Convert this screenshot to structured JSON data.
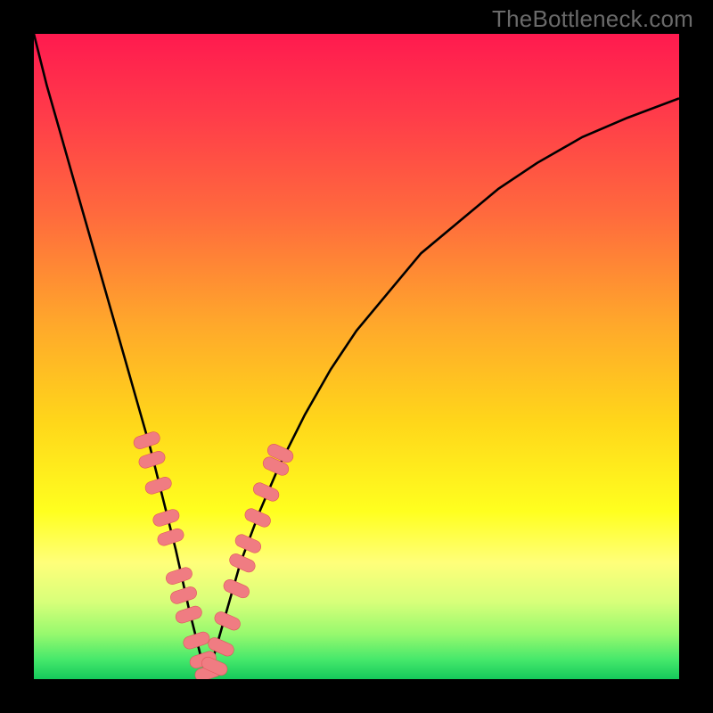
{
  "watermark": "TheBottleneck.com",
  "colors": {
    "frame": "#000000",
    "gradient_stops": [
      {
        "offset": 0.0,
        "color": "#ff1a4f"
      },
      {
        "offset": 0.12,
        "color": "#ff3a4a"
      },
      {
        "offset": 0.28,
        "color": "#ff6a3d"
      },
      {
        "offset": 0.45,
        "color": "#ffa82b"
      },
      {
        "offset": 0.6,
        "color": "#ffd61a"
      },
      {
        "offset": 0.74,
        "color": "#ffff1f"
      },
      {
        "offset": 0.82,
        "color": "#ffff7a"
      },
      {
        "offset": 0.88,
        "color": "#d8ff7a"
      },
      {
        "offset": 0.93,
        "color": "#97f96e"
      },
      {
        "offset": 0.97,
        "color": "#45e86b"
      },
      {
        "offset": 1.0,
        "color": "#15c95b"
      }
    ],
    "curve": "#000000",
    "bead_fill": "#f07c82",
    "bead_stroke": "#e0555c"
  },
  "chart_data": {
    "type": "line",
    "title": "",
    "xlabel": "",
    "ylabel": "",
    "xlim": [
      0,
      100
    ],
    "ylim": [
      0,
      100
    ],
    "grid": false,
    "legend": false,
    "notes": "Two curves starting from opposite top corners descending to meet near x≈27 at y≈0, forming a sharp V. Pink bead markers cluster on both curves in the y≈0–37 band. Background is a vertical spectral gradient (red→green). Axes are unlabeled; numeric x/y are relative 0–100 estimates from pixel position.",
    "series": [
      {
        "name": "left_curve",
        "x": [
          0,
          2,
          4,
          6,
          8,
          10,
          12,
          14,
          16,
          18,
          20,
          22,
          24,
          25,
          26,
          27
        ],
        "y": [
          100,
          92,
          85,
          78,
          71,
          64,
          57,
          50,
          43,
          36,
          28,
          20,
          11,
          7,
          3,
          0
        ]
      },
      {
        "name": "right_curve",
        "x": [
          27,
          28,
          30,
          32,
          35,
          38,
          42,
          46,
          50,
          55,
          60,
          66,
          72,
          78,
          85,
          92,
          100
        ],
        "y": [
          0,
          4,
          11,
          18,
          26,
          33,
          41,
          48,
          54,
          60,
          66,
          71,
          76,
          80,
          84,
          87,
          90
        ]
      }
    ],
    "beads": {
      "left": [
        {
          "x": 17.5,
          "y": 37
        },
        {
          "x": 18.3,
          "y": 34
        },
        {
          "x": 19.3,
          "y": 30
        },
        {
          "x": 20.5,
          "y": 25
        },
        {
          "x": 21.2,
          "y": 22
        },
        {
          "x": 22.5,
          "y": 16
        },
        {
          "x": 23.2,
          "y": 13
        },
        {
          "x": 24.0,
          "y": 10
        },
        {
          "x": 25.2,
          "y": 6
        },
        {
          "x": 26.2,
          "y": 3
        },
        {
          "x": 27.0,
          "y": 1
        }
      ],
      "right": [
        {
          "x": 28.0,
          "y": 2
        },
        {
          "x": 29.0,
          "y": 5
        },
        {
          "x": 30.0,
          "y": 9
        },
        {
          "x": 31.4,
          "y": 14
        },
        {
          "x": 32.3,
          "y": 18
        },
        {
          "x": 33.2,
          "y": 21
        },
        {
          "x": 34.7,
          "y": 25
        },
        {
          "x": 36.0,
          "y": 29
        },
        {
          "x": 37.5,
          "y": 33
        },
        {
          "x": 38.2,
          "y": 35
        }
      ]
    }
  }
}
